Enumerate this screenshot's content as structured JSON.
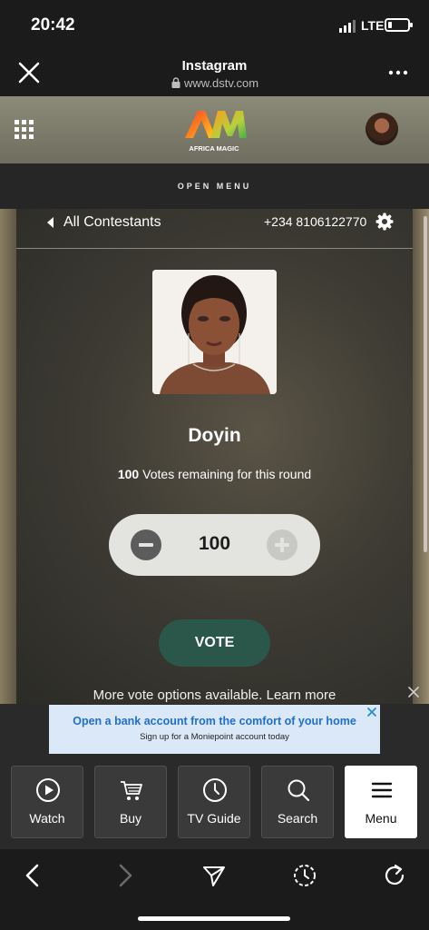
{
  "status_bar": {
    "time": "20:42",
    "network": "LTE",
    "battery_percent": 20
  },
  "browser": {
    "title": "Instagram",
    "url": "www.dstv.com"
  },
  "site": {
    "logo_text": "AFRICA MAGIC",
    "open_menu_label": "OPEN MENU"
  },
  "contestant_panel": {
    "back_label": "All Contestants",
    "phone": "+234 8106122770",
    "name": "Doyin",
    "votes_remaining": "100",
    "votes_remaining_text": "Votes remaining for this round",
    "vote_count": "100",
    "vote_button": "VOTE",
    "more_options": "More vote options available. Learn more"
  },
  "ad": {
    "headline": "Open a bank account from the comfort of your home",
    "subline": "Sign up for a Moniepoint account today"
  },
  "bottom_nav": {
    "items": [
      {
        "label": "Watch",
        "icon": "play-circle-icon"
      },
      {
        "label": "Buy",
        "icon": "cart-icon"
      },
      {
        "label": "TV Guide",
        "icon": "clock-icon"
      },
      {
        "label": "Search",
        "icon": "search-icon"
      },
      {
        "label": "Menu",
        "icon": "hamburger-icon"
      }
    ],
    "active": "Menu"
  },
  "colors": {
    "vote_button": "#2b564a",
    "ad_headline": "#1f6fd0",
    "background": "#1b1b1b"
  }
}
